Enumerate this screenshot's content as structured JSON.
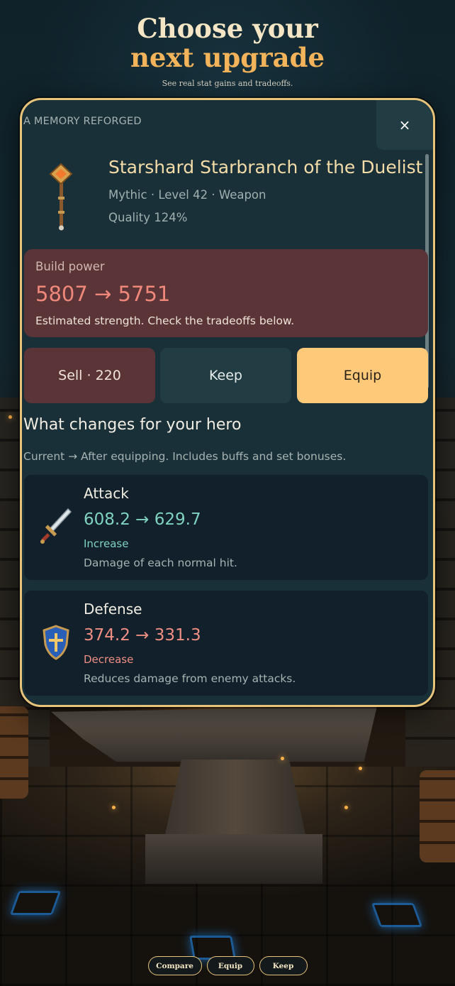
{
  "header": {
    "title_line1": "Choose your",
    "title_line2": "next upgrade",
    "subtitle": "See real stat gains and tradeoffs."
  },
  "modal": {
    "kicker": "A MEMORY REFORGED",
    "close_label": "×",
    "item": {
      "name": "Starshard Starbranch of the Duelist",
      "meta": "Mythic · Level 42 · Weapon",
      "quality": "Quality 124%",
      "icon": "staff-icon"
    },
    "power": {
      "label": "Build power",
      "value": "5807 → 5751",
      "note": "Estimated strength. Check the tradeoffs below."
    },
    "actions": {
      "sell": "Sell · 220",
      "keep": "Keep",
      "equip": "Equip"
    },
    "changes": {
      "title": "What changes for your hero",
      "subtitle": "Current → After equipping. Includes buffs and set bonuses.",
      "stats": [
        {
          "name": "Attack",
          "value": "608.2 → 629.7",
          "tag": "Increase",
          "desc": "Damage of each normal hit.",
          "icon": "sword-icon",
          "color": "#7fd3c0"
        },
        {
          "name": "Defense",
          "value": "374.2 → 331.3",
          "tag": "Decrease",
          "desc": "Reduces damage from enemy attacks.",
          "icon": "shield-icon",
          "color": "#ef8f83"
        }
      ]
    }
  },
  "footer": {
    "compare": "Compare",
    "equip": "Equip",
    "keep": "Keep"
  },
  "colors": {
    "accent_gold": "#e8c47a",
    "title_orange": "#f2b35a",
    "equip_button": "#ffc97a",
    "sell_button": "#5a3436",
    "panel": "#1a3038"
  }
}
